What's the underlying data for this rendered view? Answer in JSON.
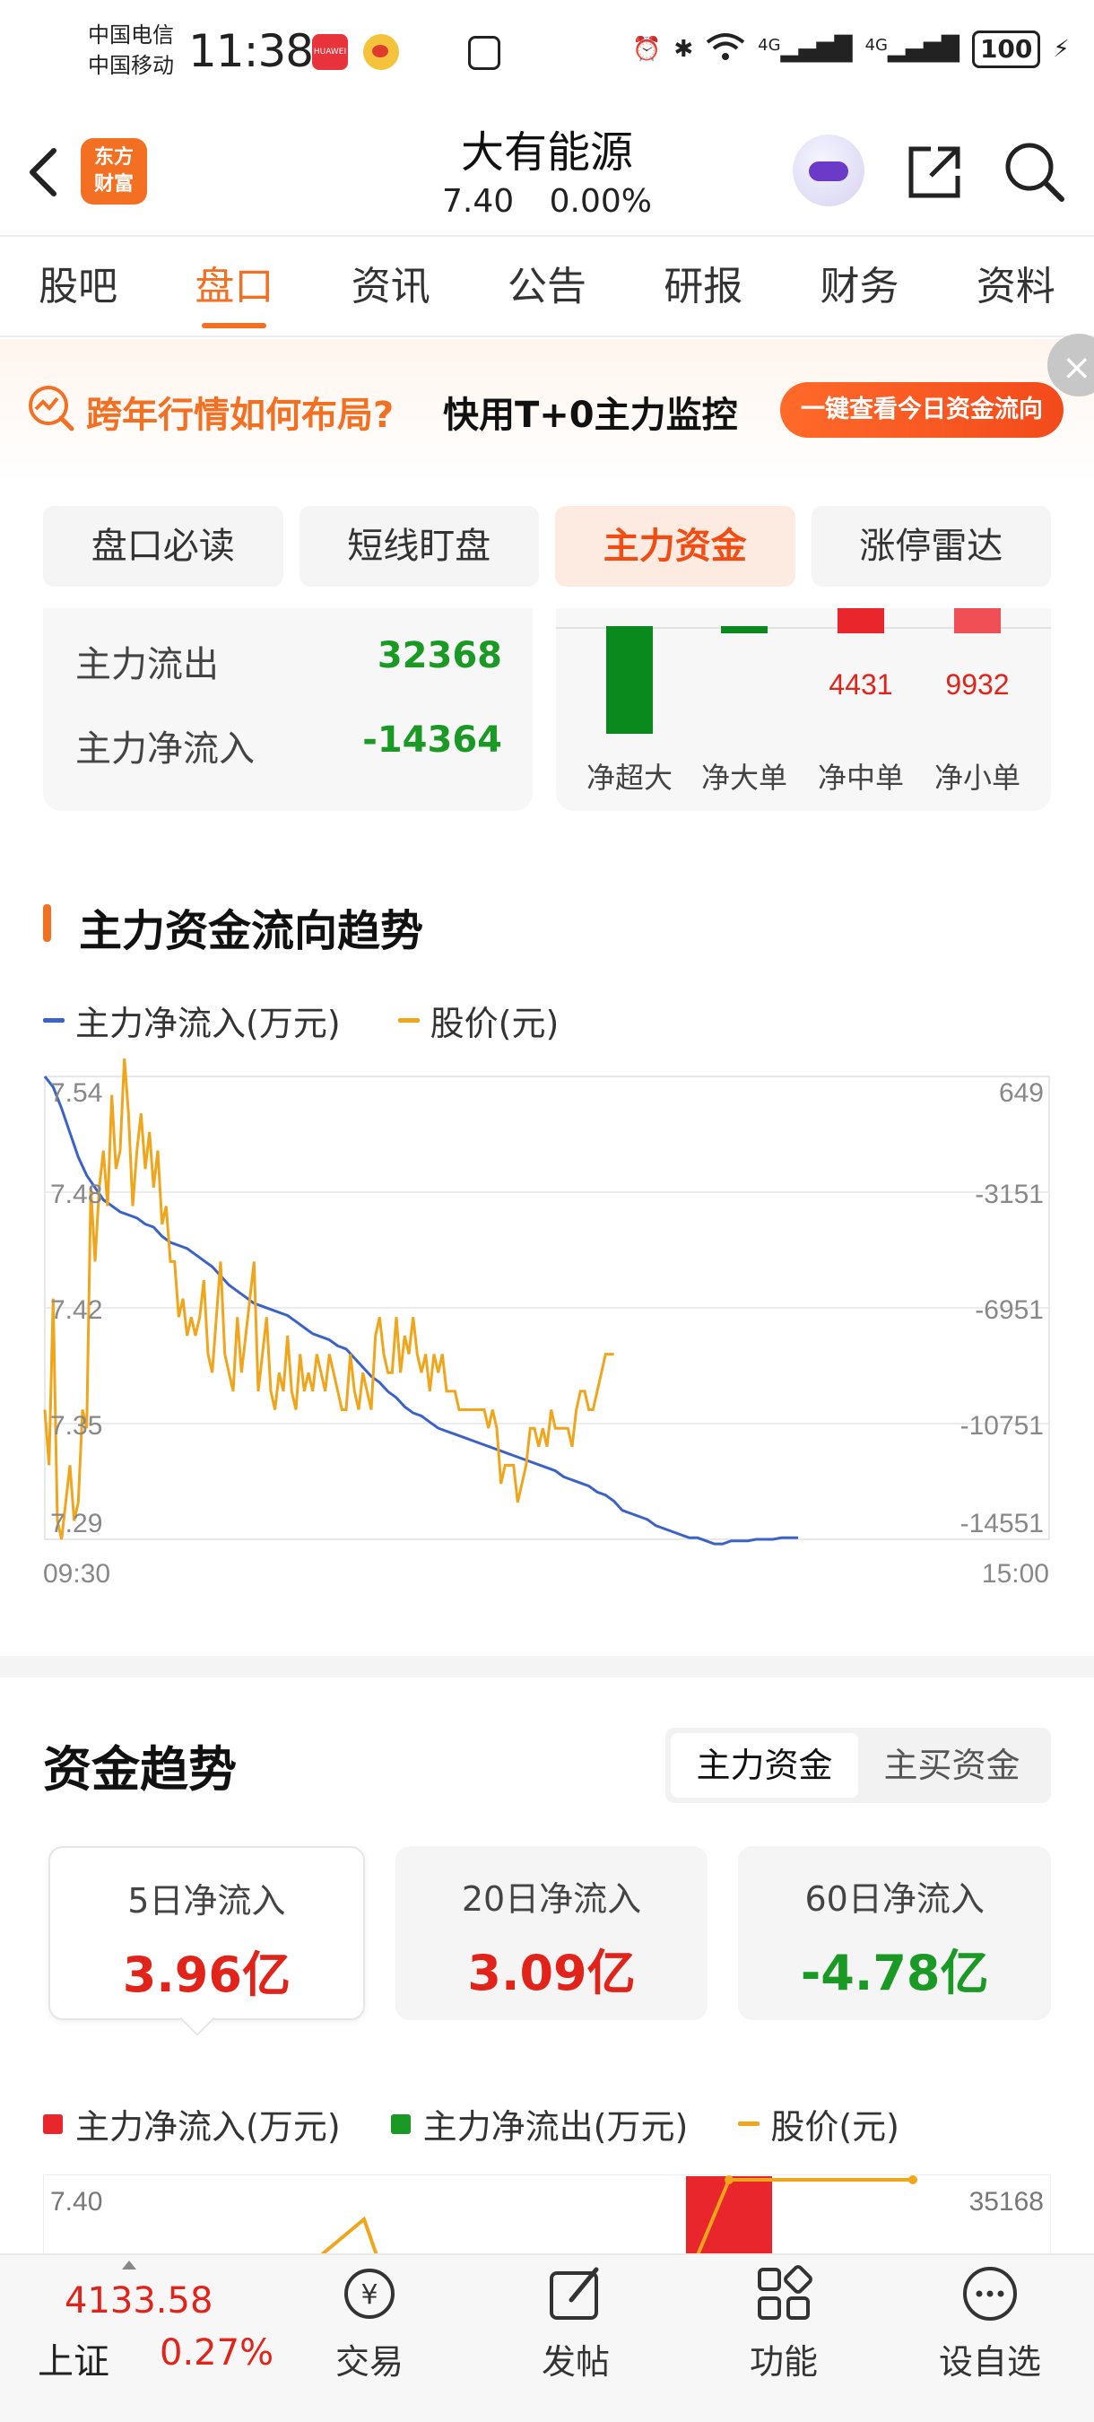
{
  "status_bar": {
    "carrier1": "中国电信",
    "carrier2": "中国移动",
    "time": "11:38",
    "app_badge": "HUAWEI",
    "net1": "4G",
    "net2": "4G",
    "battery": "100"
  },
  "header": {
    "logo_line1": "东方",
    "logo_line2": "财富",
    "title": "大有能源",
    "price": "7.40",
    "change": "0.00%"
  },
  "tabs": [
    "股吧",
    "盘口",
    "资讯",
    "公告",
    "研报",
    "财务",
    "资料"
  ],
  "active_tab": 1,
  "banner": {
    "question": "跨年行情如何布局?",
    "answer": "快用T+0主力监控",
    "button": "一键查看今日资金流向",
    "close": "×"
  },
  "subtabs": [
    "盘口必读",
    "短线盯盘",
    "主力资金",
    "涨停雷达"
  ],
  "active_subtab": 2,
  "flow_summary": {
    "outflow_label": "主力流出",
    "outflow_value": "32368",
    "net_label": "主力净流入",
    "net_value": "-14364"
  },
  "order_bars": {
    "categories": [
      "净超大",
      "净大单",
      "净中单",
      "净小单"
    ],
    "labels": [
      "",
      "",
      "4431",
      "9932"
    ],
    "colors": [
      "#0a8a1c",
      "#0a8a1c",
      "#e8262b",
      "#ef4f55"
    ]
  },
  "trend": {
    "title": "主力资金流向趋势",
    "legend_flow": "主力净流入(万元)",
    "legend_price": "股价(元)",
    "x_start": "09:30",
    "x_end": "15:00"
  },
  "chart_data": {
    "type": "line",
    "y_left_ticks": [
      "7.54",
      "7.48",
      "7.42",
      "7.35",
      "7.29"
    ],
    "y_right_ticks": [
      "649",
      "-3151",
      "-6951",
      "-10751",
      "-14551"
    ],
    "y_left_range": [
      7.29,
      7.54
    ],
    "y_right_range": [
      -14551,
      649
    ],
    "x_range_minutes": [
      0,
      240
    ],
    "series": [
      {
        "name": "主力净流入(万元)",
        "color": "#3a62c8",
        "axis": "right",
        "points": [
          [
            0,
            649
          ],
          [
            2,
            300
          ],
          [
            4,
            -400
          ],
          [
            6,
            -1200
          ],
          [
            8,
            -2000
          ],
          [
            10,
            -2600
          ],
          [
            12,
            -3000
          ],
          [
            14,
            -3400
          ],
          [
            16,
            -3600
          ],
          [
            18,
            -3800
          ],
          [
            20,
            -3900
          ],
          [
            22,
            -4000
          ],
          [
            24,
            -4200
          ],
          [
            26,
            -4300
          ],
          [
            28,
            -4600
          ],
          [
            30,
            -4800
          ],
          [
            32,
            -4900
          ],
          [
            34,
            -5000
          ],
          [
            36,
            -5200
          ],
          [
            38,
            -5400
          ],
          [
            40,
            -5600
          ],
          [
            42,
            -5900
          ],
          [
            44,
            -6200
          ],
          [
            46,
            -6400
          ],
          [
            48,
            -6600
          ],
          [
            50,
            -6800
          ],
          [
            52,
            -6900
          ],
          [
            54,
            -7000
          ],
          [
            56,
            -7100
          ],
          [
            58,
            -7200
          ],
          [
            60,
            -7400
          ],
          [
            62,
            -7600
          ],
          [
            64,
            -7800
          ],
          [
            66,
            -7900
          ],
          [
            68,
            -8000
          ],
          [
            70,
            -8200
          ],
          [
            72,
            -8300
          ],
          [
            74,
            -8600
          ],
          [
            76,
            -8900
          ],
          [
            78,
            -9200
          ],
          [
            80,
            -9400
          ],
          [
            82,
            -9700
          ],
          [
            84,
            -9900
          ],
          [
            86,
            -10200
          ],
          [
            88,
            -10400
          ],
          [
            90,
            -10500
          ],
          [
            92,
            -10700
          ],
          [
            94,
            -10900
          ],
          [
            96,
            -11000
          ],
          [
            98,
            -11100
          ],
          [
            100,
            -11200
          ],
          [
            102,
            -11300
          ],
          [
            104,
            -11400
          ],
          [
            106,
            -11500
          ],
          [
            108,
            -11600
          ],
          [
            110,
            -11700
          ],
          [
            112,
            -11800
          ],
          [
            114,
            -11900
          ],
          [
            116,
            -12000
          ],
          [
            118,
            -12100
          ],
          [
            120,
            -12200
          ],
          [
            122,
            -12300
          ],
          [
            124,
            -12500
          ],
          [
            126,
            -12600
          ],
          [
            128,
            -12700
          ],
          [
            130,
            -12800
          ],
          [
            132,
            -13000
          ],
          [
            134,
            -13100
          ],
          [
            136,
            -13300
          ],
          [
            138,
            -13600
          ],
          [
            140,
            -13700
          ],
          [
            142,
            -13800
          ],
          [
            144,
            -13900
          ],
          [
            146,
            -14100
          ],
          [
            148,
            -14200
          ],
          [
            150,
            -14300
          ],
          [
            152,
            -14400
          ],
          [
            154,
            -14500
          ],
          [
            156,
            -14500
          ],
          [
            158,
            -14600
          ],
          [
            160,
            -14700
          ],
          [
            162,
            -14700
          ],
          [
            164,
            -14600
          ],
          [
            166,
            -14600
          ],
          [
            168,
            -14600
          ],
          [
            170,
            -14550
          ],
          [
            172,
            -14550
          ],
          [
            174,
            -14550
          ],
          [
            176,
            -14500
          ],
          [
            178,
            -14500
          ],
          [
            180,
            -14500
          ]
        ]
      },
      {
        "name": "股价(元)",
        "color": "#f0a51b",
        "axis": "left",
        "points": [
          [
            0,
            7.36
          ],
          [
            1,
            7.33
          ],
          [
            2,
            7.42
          ],
          [
            3,
            7.3
          ],
          [
            4,
            7.29
          ],
          [
            5,
            7.31
          ],
          [
            6,
            7.33
          ],
          [
            7,
            7.3
          ],
          [
            8,
            7.31
          ],
          [
            9,
            7.36
          ],
          [
            10,
            7.35
          ],
          [
            11,
            7.48
          ],
          [
            12,
            7.44
          ],
          [
            13,
            7.48
          ],
          [
            14,
            7.5
          ],
          [
            15,
            7.47
          ],
          [
            16,
            7.53
          ],
          [
            17,
            7.49
          ],
          [
            18,
            7.5
          ],
          [
            19,
            7.55
          ],
          [
            20,
            7.52
          ],
          [
            21,
            7.47
          ],
          [
            22,
            7.5
          ],
          [
            23,
            7.52
          ],
          [
            24,
            7.49
          ],
          [
            25,
            7.51
          ],
          [
            26,
            7.48
          ],
          [
            27,
            7.5
          ],
          [
            28,
            7.46
          ],
          [
            29,
            7.47
          ],
          [
            30,
            7.44
          ],
          [
            31,
            7.44
          ],
          [
            32,
            7.41
          ],
          [
            33,
            7.42
          ],
          [
            34,
            7.4
          ],
          [
            35,
            7.41
          ],
          [
            36,
            7.4
          ],
          [
            37,
            7.41
          ],
          [
            38,
            7.43
          ],
          [
            39,
            7.39
          ],
          [
            40,
            7.38
          ],
          [
            41,
            7.41
          ],
          [
            42,
            7.44
          ],
          [
            43,
            7.39
          ],
          [
            44,
            7.38
          ],
          [
            45,
            7.37
          ],
          [
            46,
            7.41
          ],
          [
            47,
            7.38
          ],
          [
            48,
            7.4
          ],
          [
            49,
            7.42
          ],
          [
            50,
            7.44
          ],
          [
            51,
            7.37
          ],
          [
            52,
            7.39
          ],
          [
            53,
            7.41
          ],
          [
            54,
            7.37
          ],
          [
            55,
            7.36
          ],
          [
            56,
            7.38
          ],
          [
            57,
            7.37
          ],
          [
            58,
            7.4
          ],
          [
            59,
            7.37
          ],
          [
            60,
            7.36
          ],
          [
            61,
            7.39
          ],
          [
            62,
            7.37
          ],
          [
            63,
            7.38
          ],
          [
            64,
            7.37
          ],
          [
            65,
            7.39
          ],
          [
            66,
            7.38
          ],
          [
            67,
            7.37
          ],
          [
            68,
            7.39
          ],
          [
            69,
            7.38
          ],
          [
            70,
            7.37
          ],
          [
            71,
            7.36
          ],
          [
            72,
            7.36
          ],
          [
            73,
            7.39
          ],
          [
            74,
            7.37
          ],
          [
            75,
            7.36
          ],
          [
            76,
            7.38
          ],
          [
            77,
            7.37
          ],
          [
            78,
            7.36
          ],
          [
            79,
            7.4
          ],
          [
            80,
            7.41
          ],
          [
            81,
            7.39
          ],
          [
            82,
            7.38
          ],
          [
            83,
            7.38
          ],
          [
            84,
            7.41
          ],
          [
            85,
            7.38
          ],
          [
            86,
            7.4
          ],
          [
            87,
            7.39
          ],
          [
            88,
            7.41
          ],
          [
            89,
            7.39
          ],
          [
            90,
            7.38
          ],
          [
            91,
            7.39
          ],
          [
            92,
            7.37
          ],
          [
            93,
            7.39
          ],
          [
            94,
            7.38
          ],
          [
            95,
            7.39
          ],
          [
            96,
            7.37
          ],
          [
            97,
            7.37
          ],
          [
            98,
            7.37
          ],
          [
            99,
            7.36
          ],
          [
            100,
            7.36
          ],
          [
            101,
            7.36
          ],
          [
            102,
            7.36
          ],
          [
            103,
            7.36
          ],
          [
            104,
            7.36
          ],
          [
            105,
            7.36
          ],
          [
            106,
            7.35
          ],
          [
            107,
            7.36
          ],
          [
            108,
            7.35
          ],
          [
            109,
            7.32
          ],
          [
            110,
            7.33
          ],
          [
            111,
            7.33
          ],
          [
            112,
            7.33
          ],
          [
            113,
            7.31
          ],
          [
            114,
            7.32
          ],
          [
            115,
            7.33
          ],
          [
            116,
            7.35
          ],
          [
            117,
            7.35
          ],
          [
            118,
            7.34
          ],
          [
            119,
            7.35
          ],
          [
            120,
            7.34
          ],
          [
            121,
            7.36
          ],
          [
            122,
            7.35
          ],
          [
            123,
            7.35
          ],
          [
            124,
            7.35
          ],
          [
            125,
            7.35
          ],
          [
            126,
            7.34
          ],
          [
            127,
            7.36
          ],
          [
            128,
            7.37
          ],
          [
            129,
            7.37
          ],
          [
            130,
            7.36
          ],
          [
            131,
            7.36
          ],
          [
            132,
            7.37
          ],
          [
            133,
            7.38
          ],
          [
            134,
            7.39
          ],
          [
            135,
            7.39
          ],
          [
            136,
            7.39
          ]
        ]
      }
    ]
  },
  "fund_trend": {
    "title": "资金趋势",
    "seg": [
      "主力资金",
      "主买资金"
    ],
    "cards": [
      {
        "label": "5日净流入",
        "value": "3.96亿",
        "color": "#e2231a"
      },
      {
        "label": "20日净流入",
        "value": "3.09亿",
        "color": "#e2231a"
      },
      {
        "label": "60日净流入",
        "value": "-4.78亿",
        "color": "#1a9a24"
      }
    ],
    "legend_in": "主力净流入(万元)",
    "legend_out": "主力净流出(万元)",
    "legend_price": "股价(元)",
    "left_tick": "7.40",
    "right_tick": "35168"
  },
  "bottom_bar": {
    "index_value": "4133.58",
    "index_name": "上证",
    "index_change": "0.27%",
    "nav": [
      "交易",
      "发帖",
      "功能",
      "设自选"
    ]
  }
}
